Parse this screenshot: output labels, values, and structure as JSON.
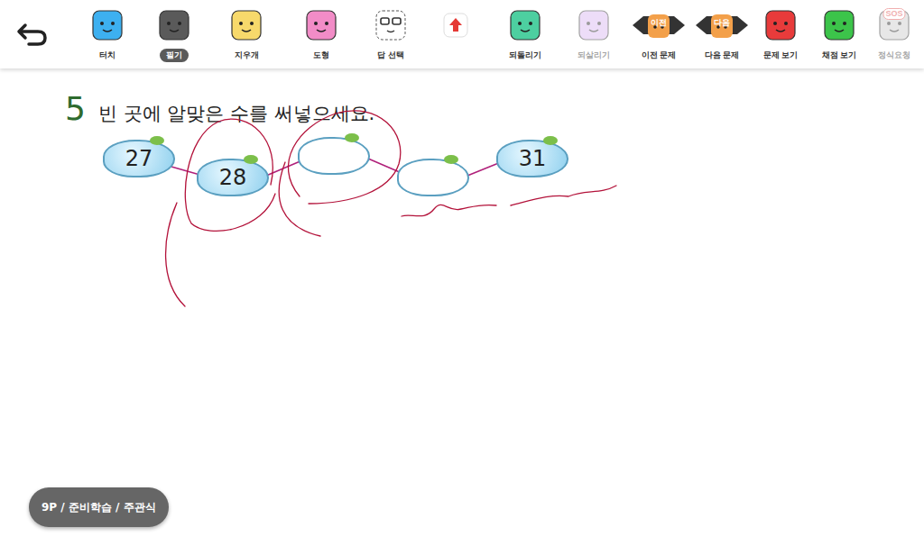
{
  "toolbar": {
    "items": [
      {
        "label": "터치",
        "kind": "face",
        "color": "#3db0f0",
        "selected": false,
        "disabled": false,
        "badge": ""
      },
      {
        "label": "필기",
        "kind": "face",
        "color": "#5a5a5a",
        "selected": true,
        "disabled": false,
        "badge": ""
      },
      {
        "label": "지우개",
        "kind": "face",
        "color": "#f7d96b",
        "selected": false,
        "disabled": false,
        "badge": ""
      },
      {
        "label": "도형",
        "kind": "face",
        "color": "#f28cc7",
        "selected": false,
        "disabled": false,
        "badge": ""
      },
      {
        "label": "답 선택",
        "kind": "select",
        "color": "#ffffff",
        "selected": false,
        "disabled": false,
        "badge": ""
      },
      {
        "label": "",
        "kind": "upload",
        "color": "#e53935",
        "selected": false,
        "disabled": false,
        "badge": ""
      },
      {
        "label": "되돌리기",
        "kind": "face",
        "color": "#4dcfa0",
        "selected": false,
        "disabled": false,
        "badge": ""
      },
      {
        "label": "되살리기",
        "kind": "face",
        "color": "#d8b6f0",
        "selected": false,
        "disabled": true,
        "badge": ""
      },
      {
        "label": "이전 문제",
        "kind": "nav",
        "color": "#f3a04a",
        "selected": false,
        "disabled": false,
        "badge": "이전"
      },
      {
        "label": "다음 문제",
        "kind": "nav",
        "color": "#f3a04a",
        "selected": false,
        "disabled": false,
        "badge": "다음"
      },
      {
        "label": "문제 보기",
        "kind": "face",
        "color": "#e83b3b",
        "selected": false,
        "disabled": false,
        "badge": ""
      },
      {
        "label": "채점 보기",
        "kind": "face",
        "color": "#3cc44a",
        "selected": false,
        "disabled": false,
        "badge": ""
      },
      {
        "label": "정식요청",
        "kind": "face",
        "color": "#cccccc",
        "selected": false,
        "disabled": true,
        "badge": "SOS"
      }
    ]
  },
  "problem": {
    "number": "5",
    "instruction": "빈 곳에 알맞은 수를 써넣으세요.",
    "stones": [
      {
        "value": "27",
        "filled": true
      },
      {
        "value": "28",
        "filled": true
      },
      {
        "value": "",
        "filled": false
      },
      {
        "value": "",
        "filled": false
      },
      {
        "value": "31",
        "filled": true
      }
    ]
  },
  "footer": {
    "label": "9P / 준비학습 / 주관식"
  }
}
